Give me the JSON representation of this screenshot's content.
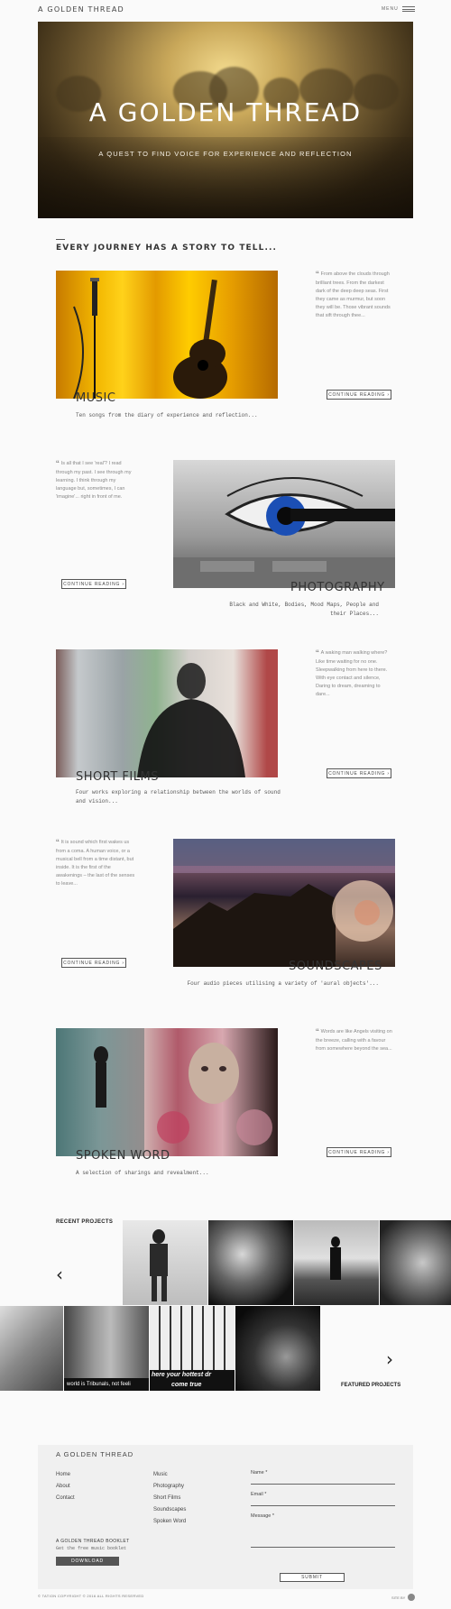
{
  "header": {
    "logo": "A GOLDEN THREAD",
    "menu_label": "MENU"
  },
  "hero": {
    "title": "A GOLDEN THREAD",
    "subtitle": "A QUEST TO FIND VOICE FOR EXPERIENCE AND REFLECTION"
  },
  "intro": {
    "title": "EVERY JOURNEY HAS A STORY TO TELL..."
  },
  "sections": [
    {
      "title": "MUSIC",
      "description": "Ten songs from the diary of experience and reflection...",
      "quote": "From above the clouds through brilliant trees. From the darkest dark of the deep deep seas. First they came as murmur, but soon they will be. Those vibrant sounds that sift through thee...",
      "button": "CONTINUE READING"
    },
    {
      "title": "PHOTOGRAPHY",
      "description": "Black and White, Bodies, Mood Maps, People and their Places...",
      "quote": "Is all that I see 'real'? I read through my past. I see through my learning. I think through my language but, sometimes, I can 'imagine'... right in front of me.",
      "button": "CONTINUE READING"
    },
    {
      "title": "SHORT FILMS",
      "description": "Four works exploring a relationship between the worlds of sound and vision...",
      "quote": "A waking man walking where? Like time waiting for no one. Sleepwalking from here to there. With eye contact and silence, Daring to dream, dreaming to dare...",
      "button": "CONTINUE READING"
    },
    {
      "title": "SOUNDSCAPES",
      "description": "Four audio pieces utilising a variety of 'aural objects'...",
      "quote": "It is sound which first wakes us from a coma. A human voice, or a musical bell from a time distant, but inside. It is the first of the awakenings – the last of the senses to leave...",
      "button": "CONTINUE READING"
    },
    {
      "title": "SPOKEN WORD",
      "description": "A selection of sharings and revealment...",
      "quote": "Words are like Angels visiting on the breeze, calling with a favour from somewhere beyond the sea...",
      "button": "CONTINUE READING"
    }
  ],
  "recent": {
    "label": "RECENT PROJECTS"
  },
  "featured": {
    "label": "FEATURED PROJECTS",
    "caption1": "world is Tribunals, not feeli",
    "caption2": "here your hottest dr",
    "caption3": "come true"
  },
  "footer": {
    "title": "A GOLDEN THREAD",
    "links_col1": [
      "Home",
      "About",
      "Contact"
    ],
    "links_col2": [
      "Music",
      "Photography",
      "Short Films",
      "Soundscapes",
      "Spoken Word"
    ],
    "booklet_title": "A GOLDEN THREAD BOOKLET",
    "booklet_sub": "Get the free music booklet",
    "download_label": "DOWNLOAD",
    "form": {
      "name_label": "Name *",
      "email_label": "Email *",
      "message_label": "Message *",
      "submit_label": "SUBMIT"
    },
    "copyright": "© TATION COPYRIGHT © 2016 ALL RIGHTS RESERVED",
    "site_by": "SITE BY"
  },
  "icons": {
    "menu": "hamburger-icon",
    "quote": "quote-icon",
    "arrow_right": "chevron-right-icon",
    "arrow_left": "chevron-left-icon"
  },
  "colors": {
    "background": "#fafafa",
    "text": "#333333",
    "hero_gold": "#c9a85a",
    "footer_bg": "#f0f0f0"
  }
}
